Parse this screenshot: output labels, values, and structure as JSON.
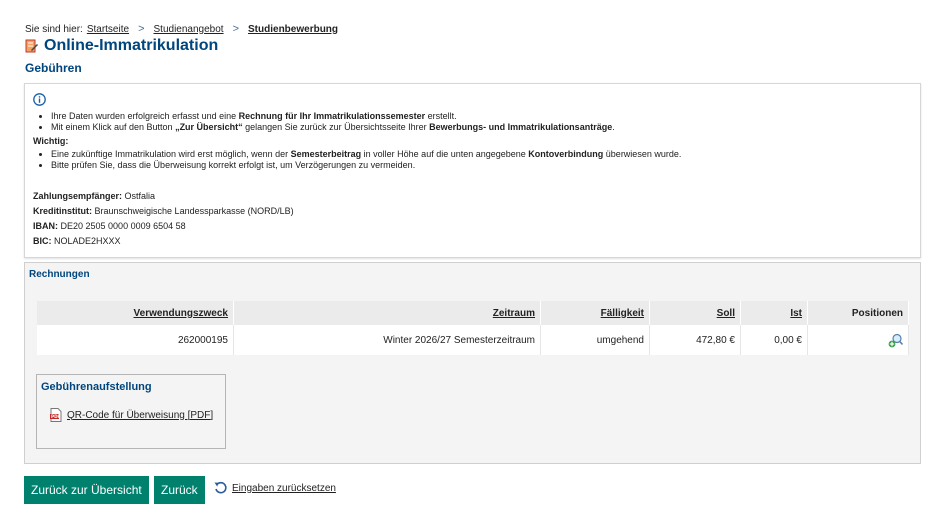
{
  "breadcrumb": {
    "prefix": "Sie sind hier:",
    "items": [
      "Startseite",
      "Studienangebot",
      "Studienbewerbung"
    ]
  },
  "page_title": "Online-Immatrikulation",
  "section_title": "Gebühren",
  "info": {
    "bullets": [
      {
        "parts": [
          "Ihre Daten wurden erfolgreich erfasst und eine ",
          "Rechnung für Ihr Immatrikulationssemester",
          " erstellt."
        ]
      },
      {
        "parts": [
          "Mit einem Klick auf den Button ",
          "„Zur Übersicht“",
          " gelangen Sie zurück zur Übersichtsseite Ihrer ",
          "Bewerbungs- und Immatrikulationsanträge",
          "."
        ]
      }
    ],
    "warning_title": "Wichtig:",
    "warning_bullets": [
      {
        "parts": [
          "Eine zukünftige Immatrikulation wird erst möglich, wenn der ",
          "Semesterbeitrag",
          " in voller Höhe auf die unten angegebene ",
          "Kontoverbindung",
          " überwiesen wurde."
        ]
      },
      {
        "parts": [
          "Bitte prüfen Sie, dass die Überweisung korrekt erfolgt ist, um Verzögerungen zu vermeiden."
        ]
      }
    ],
    "payee_label": "Zahlungsempfänger:",
    "payee_value": "Ostfalia",
    "bank_label": "Kreditinstitut:",
    "bank_value": "Braunschweigische Landessparkasse (NORD/LB)",
    "iban_label": "IBAN:",
    "iban_value": "DE20 2505 0000 0009 6504 58",
    "bic_label": "BIC:",
    "bic_value": "NOLADE2HXXX"
  },
  "invoices": {
    "title": "Rechnungen",
    "headers": [
      "Verwendungszweck",
      "Zeitraum",
      "Fälligkeit",
      "Soll",
      "Ist",
      "Positionen"
    ],
    "row": {
      "purpose": "262000195",
      "period": "Winter 2026/27 Semesterzeitraum",
      "due": "umgehend",
      "soll": "472,80 €",
      "ist": "0,00 €",
      "positions_icon": "magnifier-plus-icon"
    }
  },
  "fees": {
    "title": "Gebührenaufstellung",
    "qr_link": "QR-Code für Überweisung [PDF]",
    "qr_icon": "pdf-icon"
  },
  "actions": {
    "overview_button": "Zurück zur Übersicht",
    "back_button": "Zurück",
    "reset_link": "Eingaben zurücksetzen"
  },
  "colors": {
    "title_blue": "#00457d",
    "button_teal": "#00816e"
  }
}
